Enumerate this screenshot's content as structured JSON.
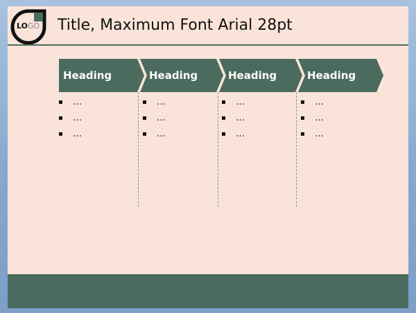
{
  "slide": {
    "logo": {
      "part1": "LO",
      "part2": "GO"
    },
    "title": "Title, Maximum Font Arial 28pt",
    "columns": [
      {
        "heading": "Heading",
        "bullets": [
          "…",
          "…",
          "…"
        ]
      },
      {
        "heading": "Heading",
        "bullets": [
          "…",
          "…",
          "…"
        ]
      },
      {
        "heading": "Heading",
        "bullets": [
          "…",
          "…",
          "…"
        ]
      },
      {
        "heading": "Heading",
        "bullets": [
          "…",
          "…",
          "…"
        ]
      }
    ]
  },
  "colors": {
    "accent": "#4a6b5d",
    "slide_background": "#fae4da",
    "outer_background": "#86a8cf"
  },
  "icons": {
    "logo": "logo-badge-icon",
    "bullet": "square-bullet-icon"
  }
}
